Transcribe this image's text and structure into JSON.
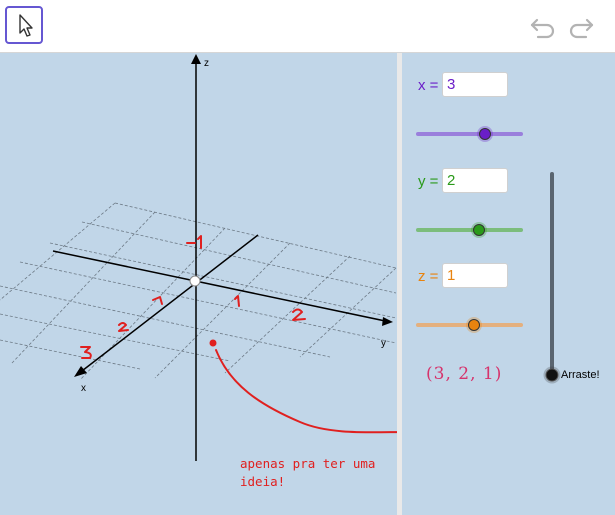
{
  "toolbar": {
    "move_tool_icon": "cursor-arrow-icon",
    "undo_icon": "undo-icon",
    "redo_icon": "redo-icon"
  },
  "graphics3d": {
    "axes": {
      "x": "x",
      "y": "y",
      "z": "z"
    },
    "handwritten_ticks": [
      "1",
      "2",
      "3",
      "1",
      "1",
      "2",
      "-1"
    ],
    "annotation": "apenas pra ter uma ideia!",
    "colors": {
      "background": "#c1d6e8",
      "annotation": "#e0201f"
    }
  },
  "algebra": {
    "x": {
      "label": "x =",
      "value": "3",
      "color": "#6a1ec8",
      "slider_color": "#9a7fdc",
      "handle_color": "#6a1ec8",
      "level": 0.62
    },
    "y": {
      "label": "y =",
      "value": "2",
      "color": "#2a9a1a",
      "slider_color": "#7cbd7c",
      "handle_color": "#2a9a1a",
      "level": 0.58
    },
    "z": {
      "label": "z =",
      "value": "1",
      "color": "#e8830f",
      "slider_color": "#e4b07e",
      "handle_color": "#e8830f",
      "level": 0.55
    },
    "point": "(3,  2,  1)",
    "point_color": "#d6336c",
    "drag_slider": {
      "label": "Arraste!",
      "level": 0.0
    }
  }
}
